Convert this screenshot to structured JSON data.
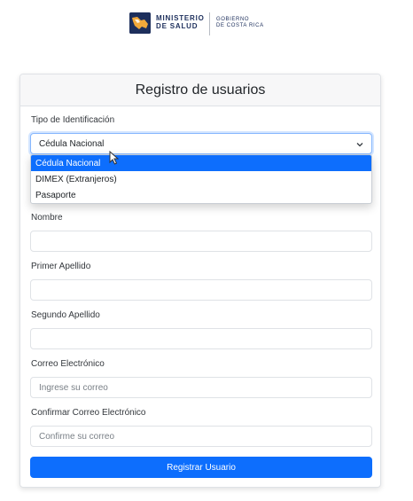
{
  "header": {
    "brand_line1": "MINISTERIO",
    "brand_line2": "DE SALUD",
    "gov_line1": "GOBIERNO",
    "gov_line2": "DE COSTA RICA"
  },
  "form": {
    "title": "Registro de usuarios",
    "id_type": {
      "label": "Tipo de Identificación",
      "selected": "Cédula Nacional",
      "options": [
        "Cédula Nacional",
        "DIMEX (Extranjeros)",
        "Pasaporte"
      ]
    },
    "nombre": {
      "label": "Nombre",
      "value": ""
    },
    "primer_apellido": {
      "label": "Primer Apellido",
      "value": ""
    },
    "segundo_apellido": {
      "label": "Segundo Apellido",
      "value": ""
    },
    "correo": {
      "label": "Correo Electrónico",
      "placeholder": "Ingrese su correo"
    },
    "confirmar_correo": {
      "label": "Confirmar Correo Electrónico",
      "placeholder": "Confirme su correo"
    },
    "submit_label": "Registrar Usuario"
  },
  "colors": {
    "primary": "#0d6efd",
    "brand_navy": "#1d2f5c"
  }
}
